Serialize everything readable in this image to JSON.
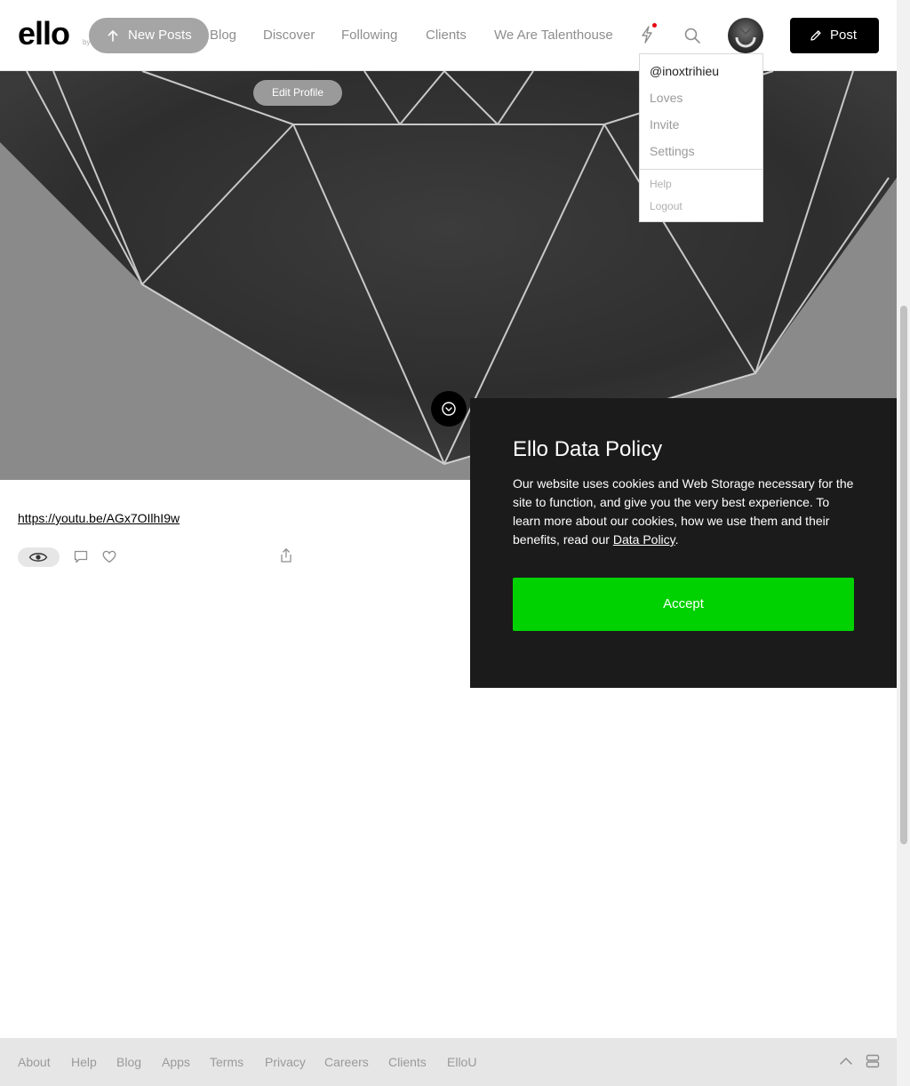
{
  "header": {
    "logo": "ello",
    "logo_by": "by",
    "new_posts": "New Posts",
    "nav": [
      "Blog",
      "Discover",
      "Following",
      "Clients",
      "We Are Talenthouse"
    ],
    "post_button": "Post"
  },
  "profile": {
    "edit_profile": "Edit Profile"
  },
  "user_menu": {
    "handle": "@inoxtrihieu",
    "items": [
      "Loves",
      "Invite",
      "Settings"
    ],
    "secondary": [
      "Help",
      "Logout"
    ]
  },
  "post": {
    "link": "https://youtu.be/AGx7OIlhI9w"
  },
  "data_policy": {
    "title": "Ello Data Policy",
    "body": "Our website uses cookies and Web Storage necessary for the site to function, and give you the very best experience. To learn more about our cookies, how we use them and their benefits, read our ",
    "link": "Data Policy",
    "body_end": ".",
    "accept": "Accept"
  },
  "footer": {
    "links": [
      "About",
      "Help",
      "Blog",
      "Apps",
      "Terms",
      "Privacy",
      "Careers",
      "Clients",
      "ElloU"
    ]
  },
  "colors": {
    "accept_green": "#00d100",
    "notification_red": "#e8000d",
    "modal_bg": "#1b1b1b"
  }
}
